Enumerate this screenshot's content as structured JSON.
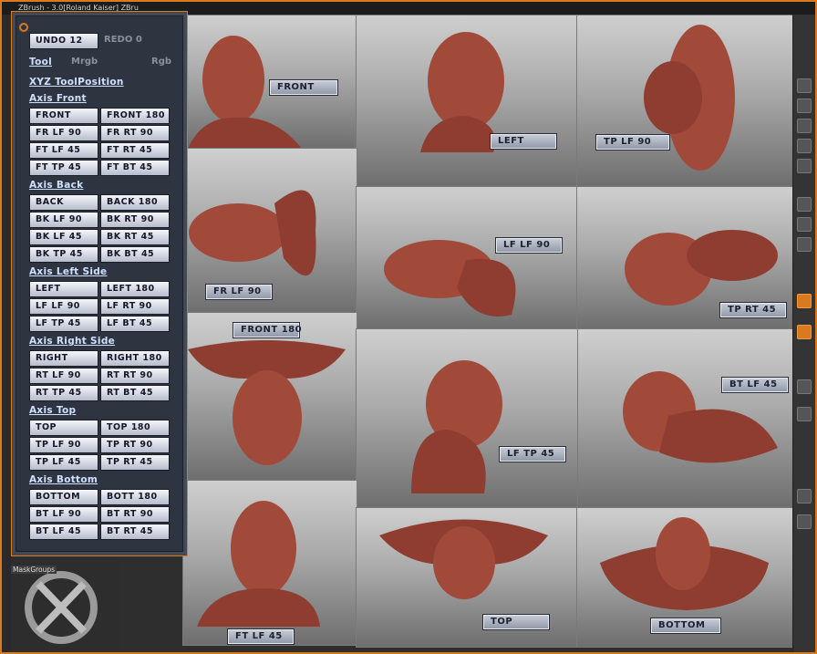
{
  "window": {
    "title": "ZBrush - 3.0[Roland Kaiser] ZBru",
    "accent": "#d97a1e"
  },
  "palette": {
    "undo": "UNDO 12",
    "redo": "REDO 0",
    "tool": "Tool",
    "mrgb": "Mrgb",
    "rgb": "Rgb",
    "title": "XYZ ToolPosition",
    "sections": [
      {
        "heading": "Axis Front",
        "buttons": [
          "FRONT",
          "FRONT 180",
          "FR LF 90",
          "FR RT 90",
          "FT LF 45",
          "FT RT 45",
          "FT TP 45",
          "FT BT 45"
        ]
      },
      {
        "heading": "Axis Back",
        "buttons": [
          "BACK",
          "BACK 180",
          "BK LF 90",
          "BK RT 90",
          "BK LF 45",
          "BK RT 45",
          "BK TP 45",
          "BK BT 45"
        ]
      },
      {
        "heading": "Axis Left Side",
        "buttons": [
          "LEFT",
          "LEFT 180",
          "LF LF 90",
          "LF RT 90",
          "LF TP 45",
          "LF BT 45"
        ]
      },
      {
        "heading": "Axis Right Side",
        "buttons": [
          "RIGHT",
          "RIGHT 180",
          "RT LF 90",
          "RT RT 90",
          "RT TP 45",
          "RT BT 45"
        ]
      },
      {
        "heading": "Axis Top",
        "buttons": [
          "TOP",
          "TOP 180",
          "TP LF 90",
          "TP RT 90",
          "TP LF 45",
          "TP RT 45"
        ]
      },
      {
        "heading": "Axis Bottom",
        "buttons": [
          "BOTTOM",
          "BOTT 180",
          "BT LF 90",
          "BT RT 90",
          "BT LF 45",
          "BT RT 45"
        ]
      }
    ]
  },
  "views": {
    "front": "FRONT",
    "left": "LEFT",
    "tp_lf_90": "TP LF 90",
    "fr_lf_90": "FR LF 90",
    "lf_lf_90": "LF LF 90",
    "tp_rt_45": "TP RT 45",
    "front_180": "FRONT 180",
    "bt_lf_45": "BT LF 45",
    "lf_tp_45": "LF TP 45",
    "ft_lf_45": "FT LF 45",
    "top": "TOP",
    "bottom": "BOTTOM"
  },
  "maskgroups": "MaskGroups",
  "colors": {
    "clay": "#a24a3a",
    "clay_dark": "#6e2a22",
    "button_text": "#15172a",
    "heading": "#cfe0ff"
  }
}
